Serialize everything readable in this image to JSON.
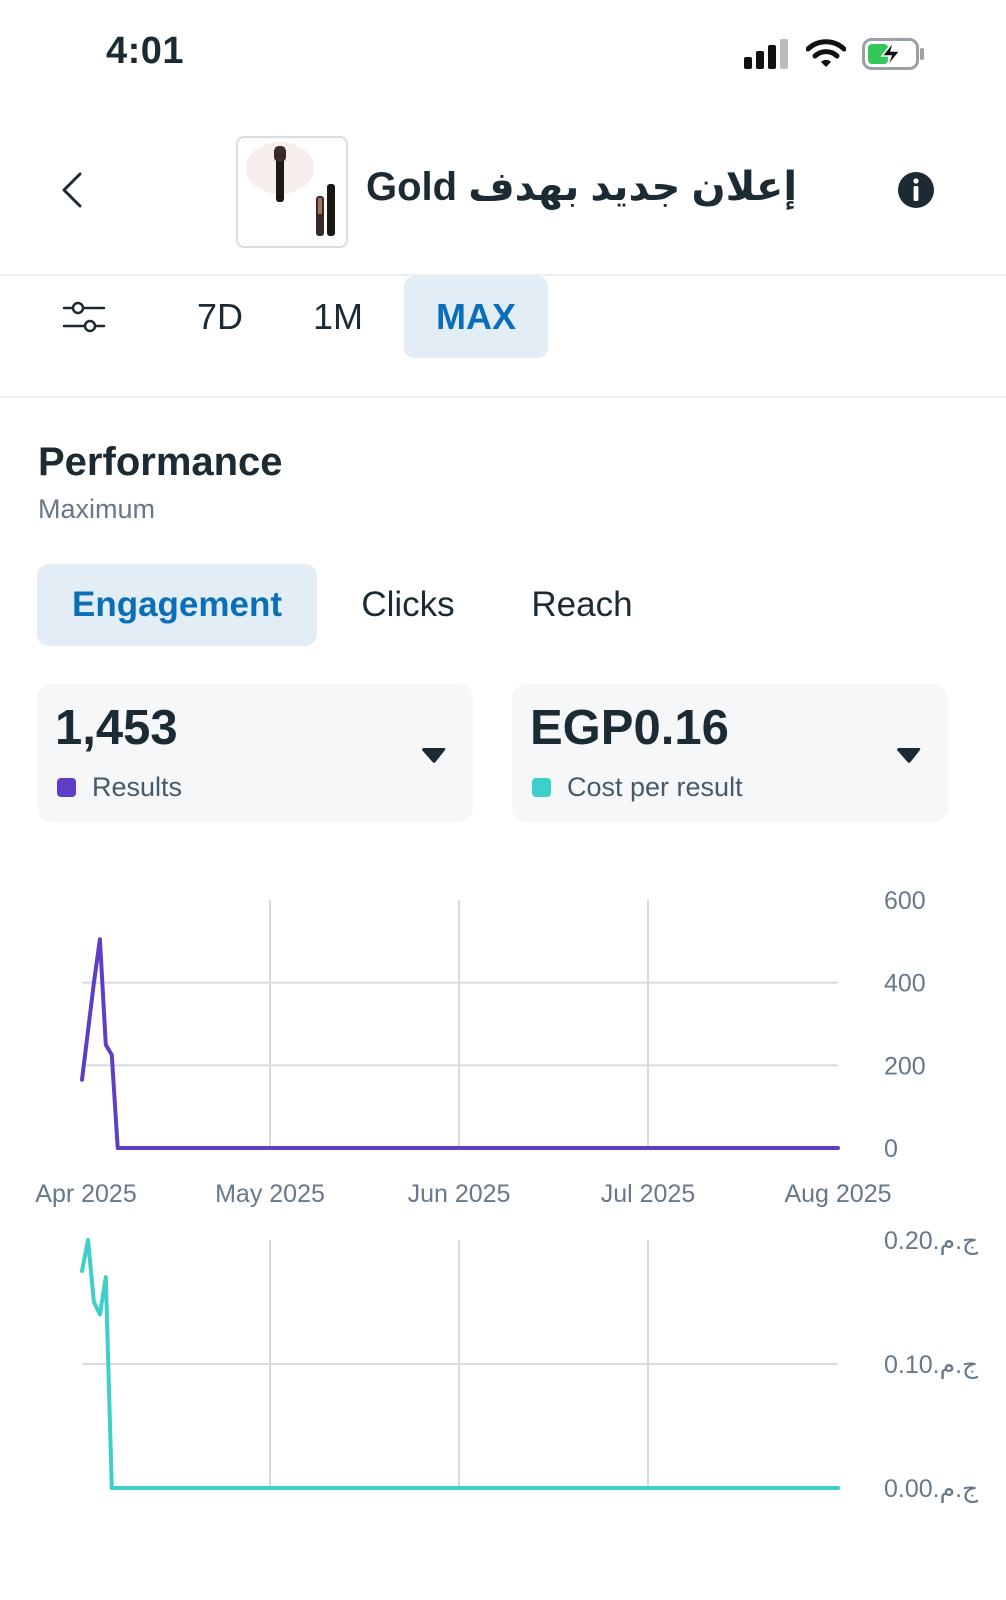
{
  "status_bar": {
    "time": "4:01",
    "icons": [
      "cellular-signal-icon",
      "wifi-icon",
      "battery-charging-icon"
    ]
  },
  "header": {
    "title": "Gold إعلان جديد بهدف",
    "icons": [
      "back-chevron-icon",
      "ad-thumbnail",
      "info-icon"
    ]
  },
  "date_range": {
    "tabs": [
      {
        "label": "7D",
        "active": false
      },
      {
        "label": "1M",
        "active": false
      },
      {
        "label": "MAX",
        "active": true
      }
    ]
  },
  "performance": {
    "title": "Performance",
    "subtitle": "Maximum",
    "metric_tabs": [
      {
        "label": "Engagement",
        "active": true
      },
      {
        "label": "Clicks",
        "active": false
      },
      {
        "label": "Reach",
        "active": false
      }
    ],
    "cards": [
      {
        "value": "1,453",
        "label": "Results",
        "color": "#5e3ec5"
      },
      {
        "value": "EGP0.16",
        "label": "Cost per result",
        "color": "#3ecfcb"
      }
    ]
  },
  "chart_data": [
    {
      "type": "line",
      "x_tick_labels": [
        "Apr 2025",
        "May 2025",
        "Jun 2025",
        "Jul 2025",
        "Aug 2025"
      ],
      "y_tick_labels": [
        "600",
        "400",
        "200",
        "0"
      ],
      "ylim": [
        0,
        600
      ],
      "xlim": [
        "2025-03-27",
        "2025-08-01"
      ],
      "grid": true,
      "series": [
        {
          "color": "#5e3ec5",
          "x": [
            "2025-03-27",
            "2025-03-29",
            "2025-03-30",
            "2025-03-31",
            "2025-04-01",
            "2025-04-02",
            "2025-04-03",
            "2025-05-01",
            "2025-06-01",
            "2025-07-01",
            "2025-08-01"
          ],
          "y": [
            165,
            400,
            505,
            250,
            225,
            0,
            0,
            0,
            0,
            0,
            0
          ]
        }
      ]
    },
    {
      "type": "line",
      "x_tick_labels": [],
      "y_tick_labels": [
        "ج.م.‏0.20",
        "ج.م.‏0.10",
        "ج.م.‏0.00"
      ],
      "ylim": [
        0,
        0.2
      ],
      "xlim": [
        "2025-03-27",
        "2025-08-01"
      ],
      "grid": true,
      "series": [
        {
          "color": "#3ecfcb",
          "x": [
            "2025-03-27",
            "2025-03-28",
            "2025-03-29",
            "2025-03-30",
            "2025-03-31",
            "2025-04-01",
            "2025-04-02",
            "2025-04-03",
            "2025-05-01",
            "2025-06-01",
            "2025-07-01",
            "2025-08-01"
          ],
          "y": [
            0.175,
            0.2,
            0.15,
            0.14,
            0.17,
            0.0,
            0.0,
            0.0,
            0.0,
            0.0,
            0.0,
            0.0
          ]
        }
      ]
    }
  ]
}
